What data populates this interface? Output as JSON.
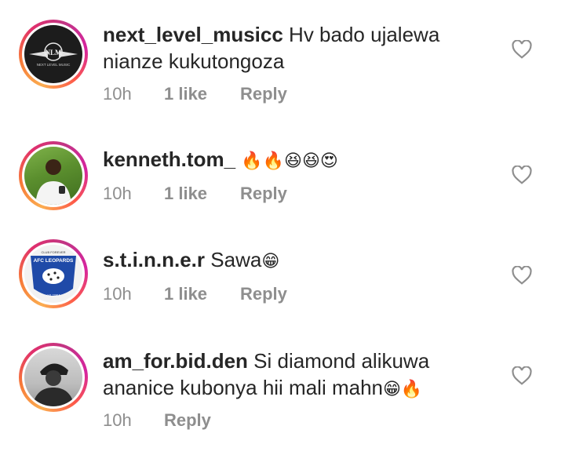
{
  "comments": [
    {
      "username": "next_level_musicc",
      "text_line1": "Hv bado ujalewa",
      "text_line2": "nianze kukutongoza",
      "emoji": "",
      "time": "10h",
      "likes": "1 like",
      "reply": "Reply",
      "avatar_text": "NLM",
      "avatar_sub": "NEXT LEVEL MUSIC"
    },
    {
      "username": "kenneth.tom_",
      "text_line1": "",
      "text_line2": "",
      "emoji": "🔥🔥😆😆😍",
      "time": "10h",
      "likes": "1 like",
      "reply": "Reply"
    },
    {
      "username": "s.t.i.n.n.e.r",
      "text_line1": "Sawa",
      "text_line2": "",
      "emoji": "😁",
      "time": "10h",
      "likes": "1 like",
      "reply": "Reply",
      "avatar_text": "AFC LEOPARDS",
      "avatar_top": "CLUB FOREVER",
      "avatar_sub": "est.1964"
    },
    {
      "username": "am_for.bid.den",
      "text_line1": "Si diamond alikuwa",
      "text_line2": "ananice kubonya hii mali mahn",
      "emoji": "😁🔥",
      "time": "10h",
      "likes": "",
      "reply": "Reply"
    }
  ],
  "colors": {
    "text": "#262626",
    "muted": "#8e8e8e",
    "ring_start": "#fbad50",
    "ring_end": "#c13584"
  },
  "icons": {
    "like": "heart-outline-icon"
  }
}
